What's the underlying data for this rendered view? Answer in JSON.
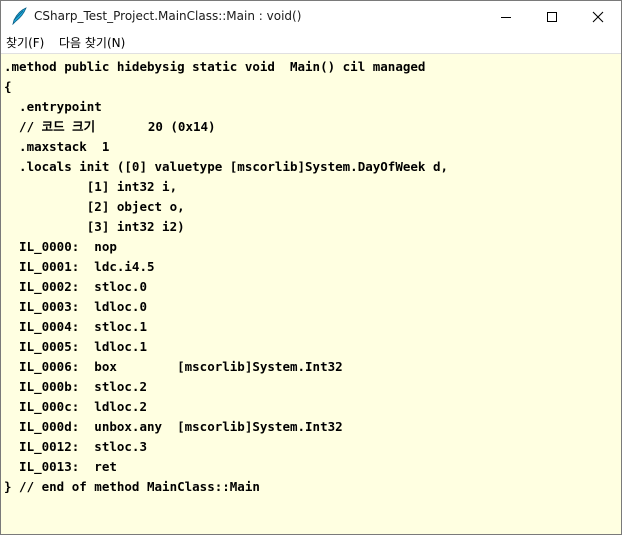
{
  "window": {
    "title": "CSharp_Test_Project.MainClass::Main : void()"
  },
  "menu": {
    "find_label": "찾기(F)",
    "find_next_label": "다음 찾기(N)"
  },
  "icons": {
    "app": "quill-pen-icon",
    "minimize": "minimize-icon",
    "maximize": "maximize-icon",
    "close": "close-icon"
  },
  "code": {
    "lines": [
      ".method public hidebysig static void  Main() cil managed",
      "{",
      "  .entrypoint",
      "  // 코드 크기       20 (0x14)",
      "  .maxstack  1",
      "  .locals init ([0] valuetype [mscorlib]System.DayOfWeek d,",
      "           [1] int32 i,",
      "           [2] object o,",
      "           [3] int32 i2)",
      "  IL_0000:  nop",
      "  IL_0001:  ldc.i4.5",
      "  IL_0002:  stloc.0",
      "  IL_0003:  ldloc.0",
      "  IL_0004:  stloc.1",
      "  IL_0005:  ldloc.1",
      "  IL_0006:  box        [mscorlib]System.Int32",
      "  IL_000b:  stloc.2",
      "  IL_000c:  ldloc.2",
      "  IL_000d:  unbox.any  [mscorlib]System.Int32",
      "  IL_0012:  stloc.3",
      "  IL_0013:  ret",
      "} // end of method MainClass::Main"
    ]
  }
}
